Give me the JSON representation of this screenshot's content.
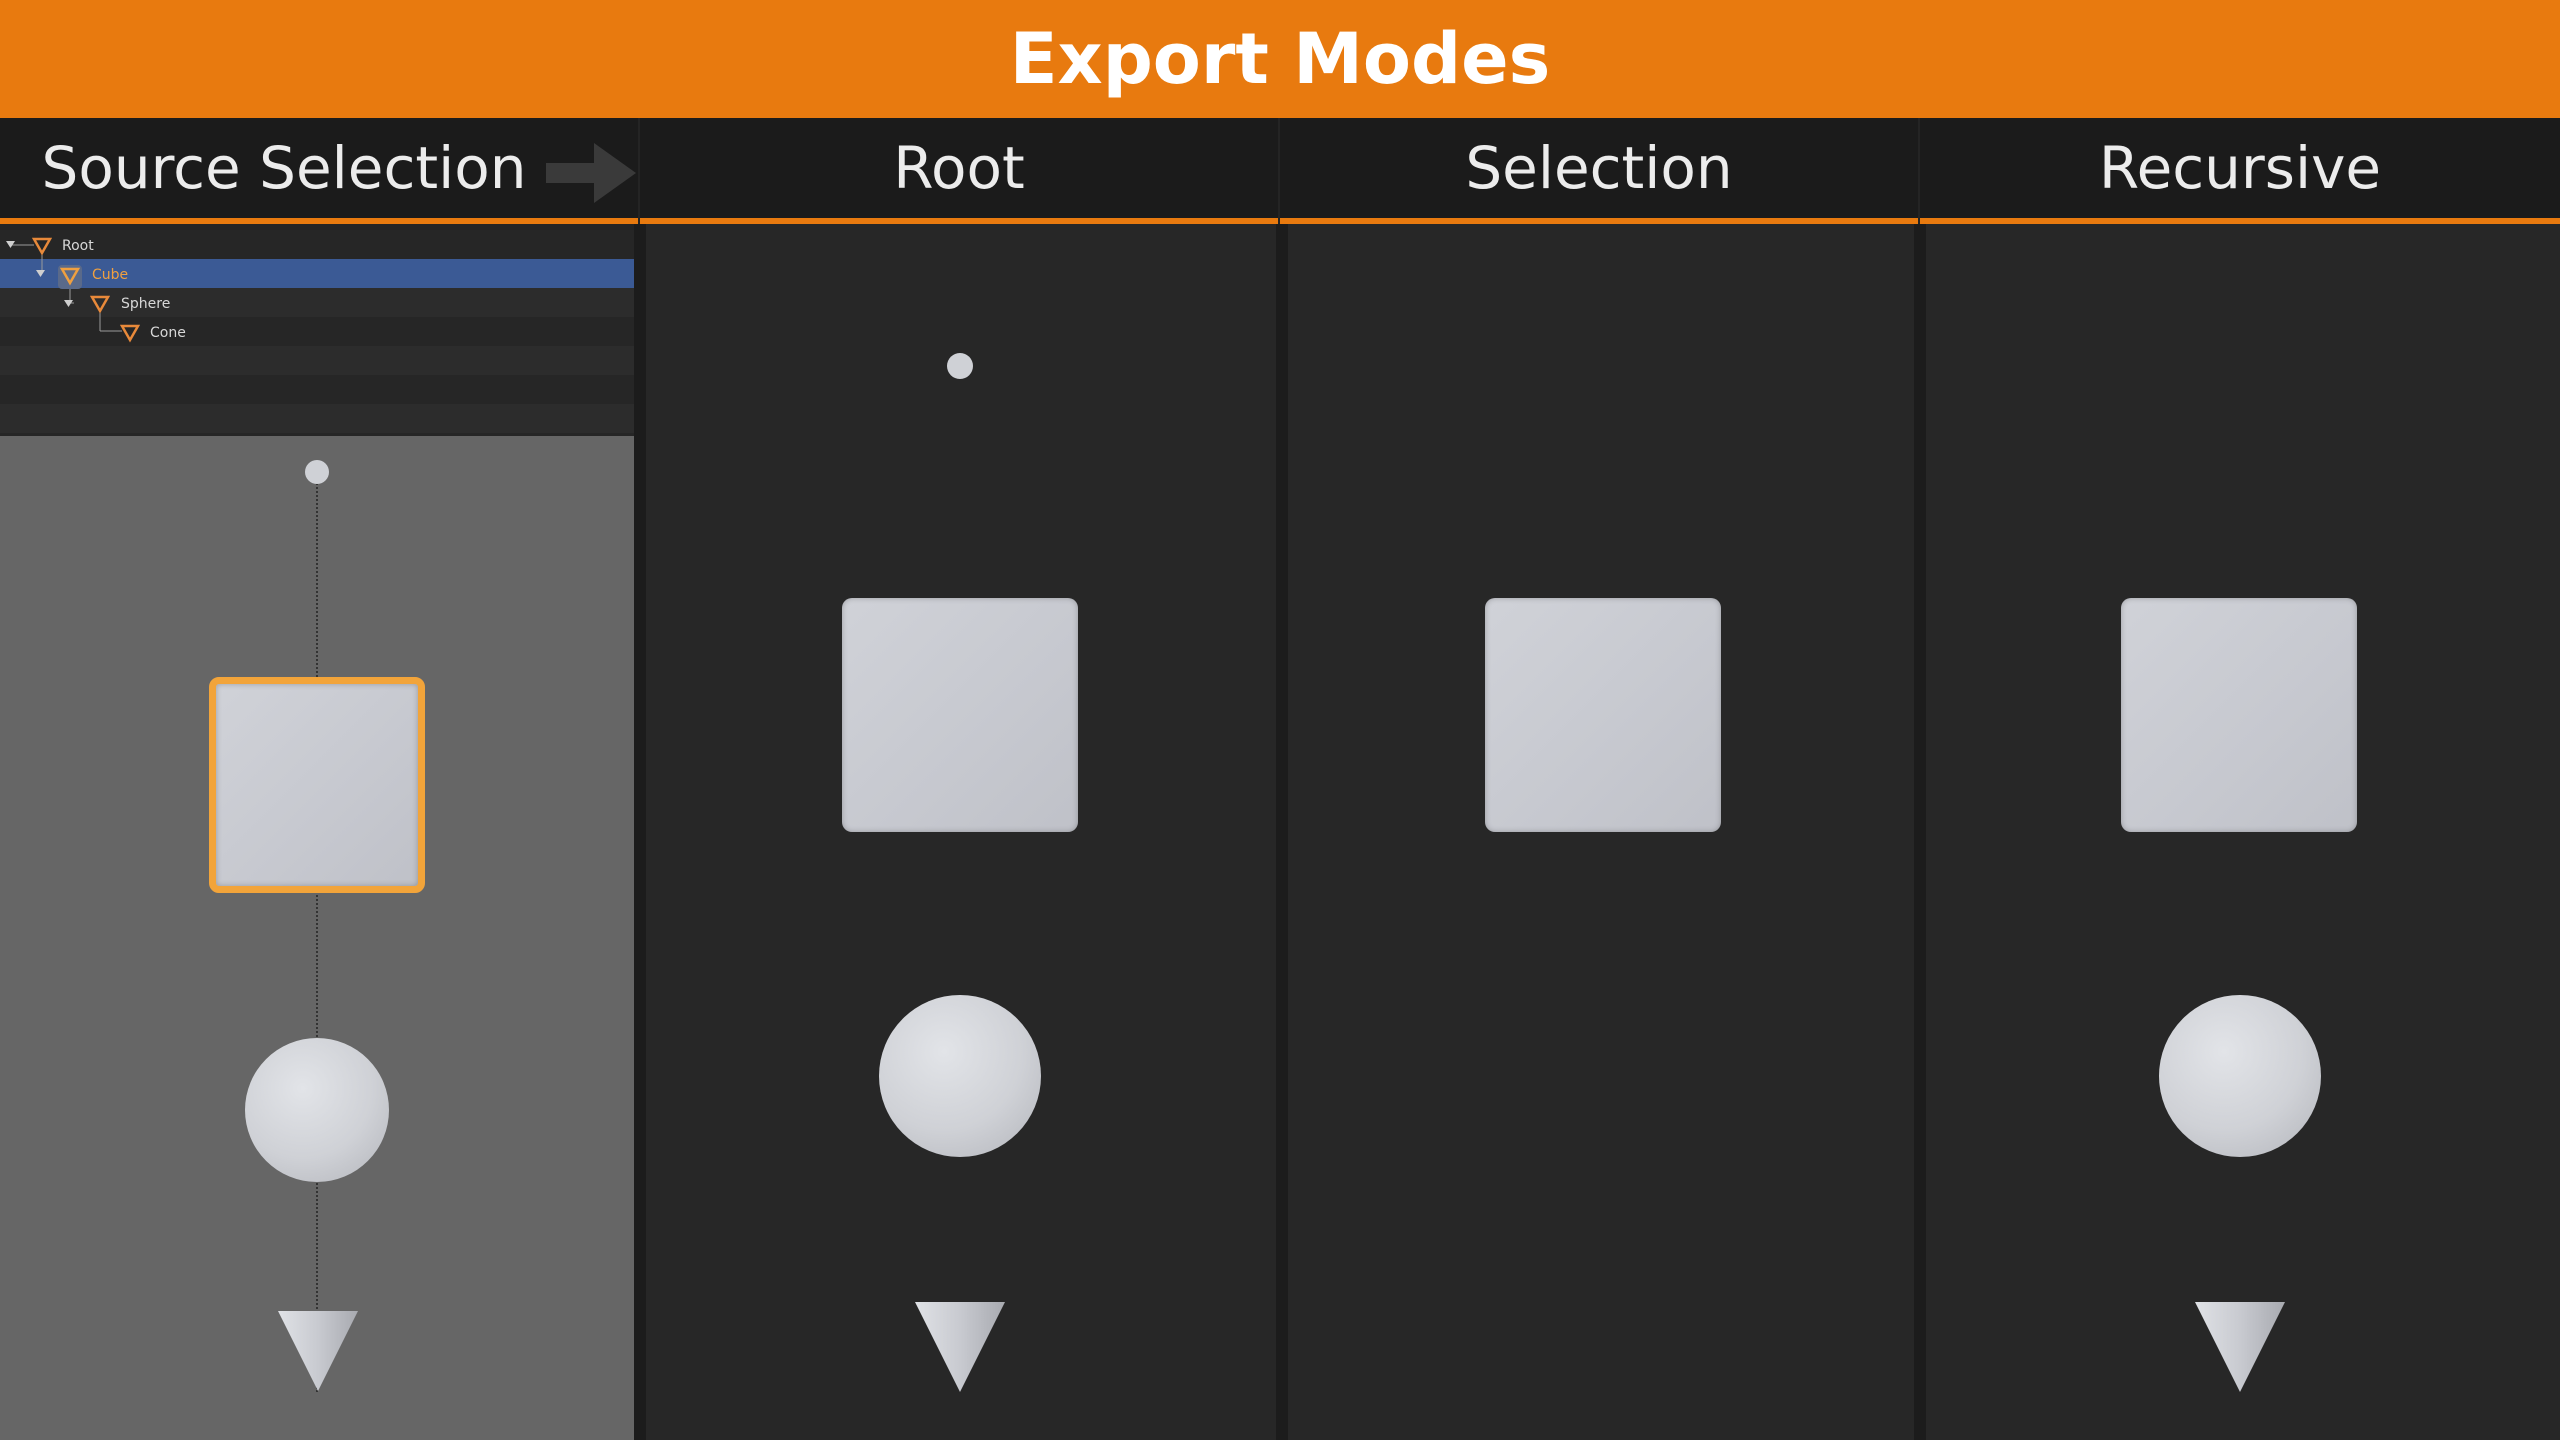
{
  "title": "Export Modes",
  "columns": [
    {
      "label": "Source Selection"
    },
    {
      "label": "Root"
    },
    {
      "label": "Selection"
    },
    {
      "label": "Recursive"
    }
  ],
  "outliner": {
    "items": [
      {
        "label": "Root",
        "depth": 0,
        "selected": false
      },
      {
        "label": "Cube",
        "depth": 1,
        "selected": true
      },
      {
        "label": "Sphere",
        "depth": 2,
        "selected": false
      },
      {
        "label": "Cone",
        "depth": 3,
        "selected": false
      }
    ]
  },
  "colors": {
    "accent": "#e87a0f",
    "selection_outline": "#f2a43a",
    "outliner_selected_row": "#3b5a95"
  },
  "icons": [
    "arrow-right-icon",
    "mesh-triangle-icon",
    "expand-triangle-icon"
  ]
}
